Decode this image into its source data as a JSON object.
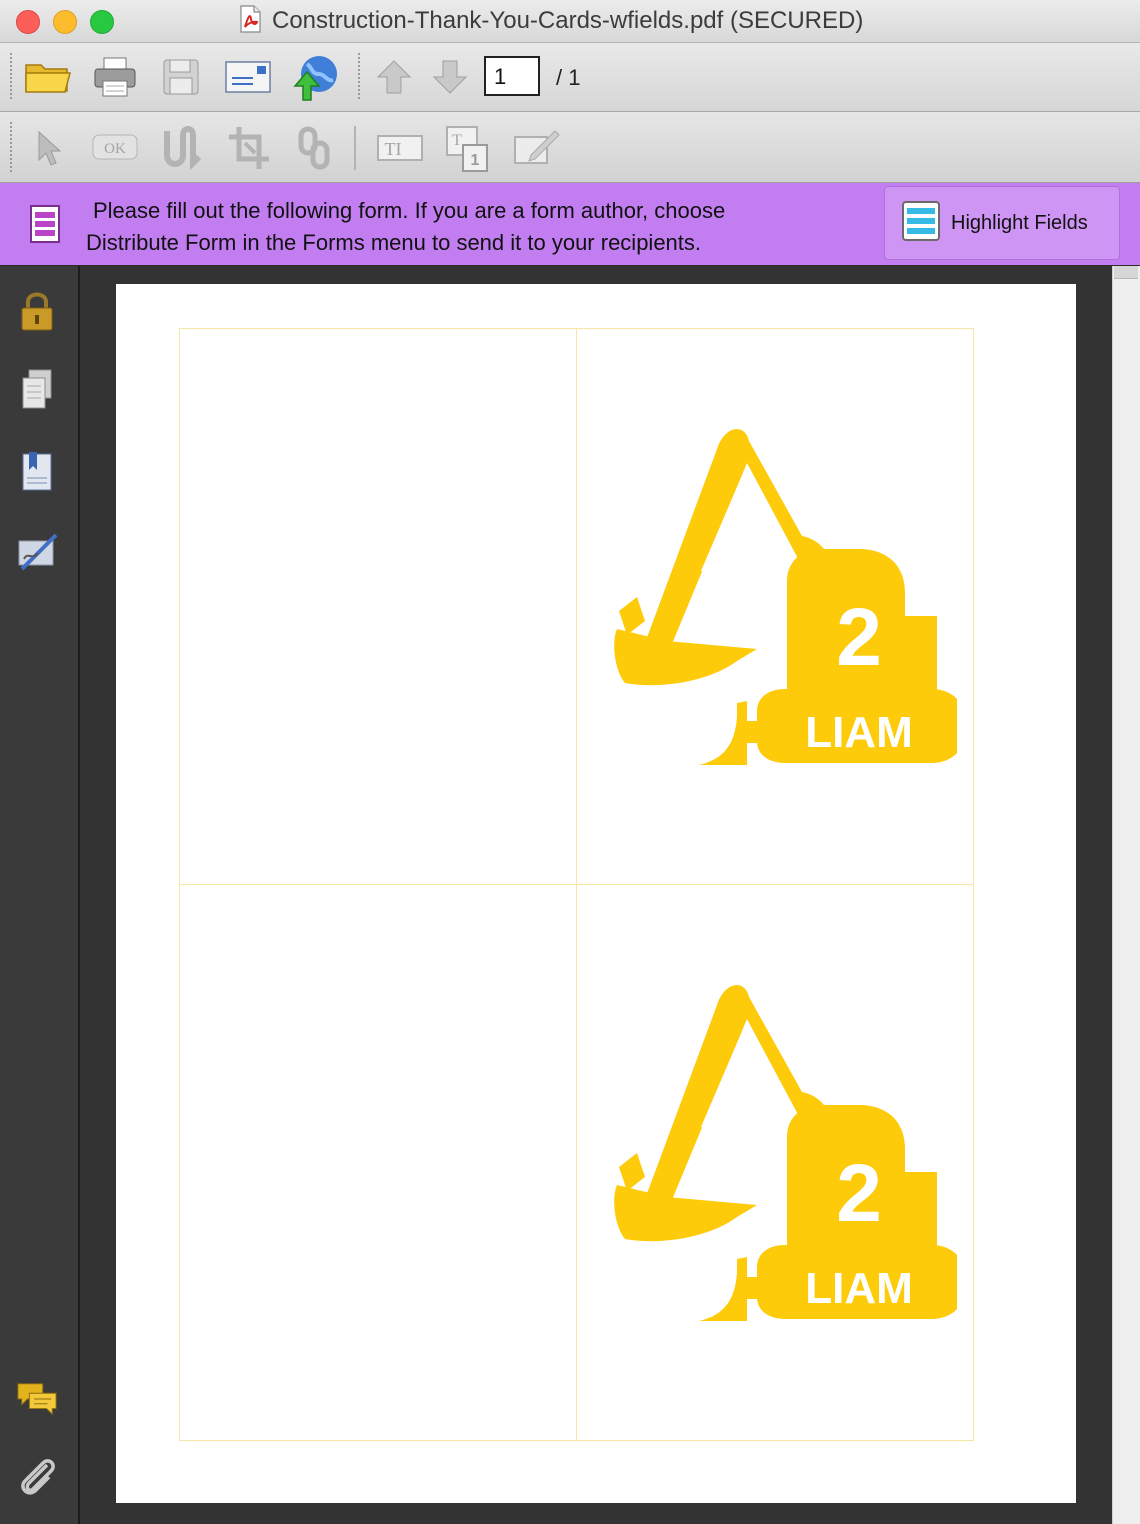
{
  "window": {
    "title": "Construction-Thank-You-Cards-wfields.pdf (SECURED)"
  },
  "toolbar": {
    "page_number": "1",
    "page_total": "/ 1"
  },
  "form_bar": {
    "message_line1": "Please fill out the following form. If you are a form author, choose",
    "message_line2": "Distribute Form in the Forms menu to send it to your recipients.",
    "highlight_label": "Highlight Fields"
  },
  "document": {
    "cards": [
      {
        "number": "2",
        "name": "LIAM"
      },
      {
        "number": "2",
        "name": "LIAM"
      }
    ]
  },
  "colors": {
    "form_bar": "#c27ef0",
    "excavator_yellow": "#fdcb0a",
    "card_border": "#f8e6a6"
  },
  "icons": [
    "pdf-file-icon",
    "open-folder-icon",
    "print-icon",
    "save-icon",
    "email-icon",
    "upload-web-icon",
    "page-up-icon",
    "page-down-icon",
    "select-arrow-icon",
    "ok-button-tool-icon",
    "loop-tool-icon",
    "crop-tool-icon",
    "link-tool-icon",
    "text-field-tool-icon",
    "text-box-tool-icon",
    "sign-tool-icon",
    "form-icon",
    "highlight-fields-icon",
    "lock-icon",
    "pages-icon",
    "bookmarks-icon",
    "signatures-icon",
    "comments-icon",
    "attachments-icon"
  ]
}
